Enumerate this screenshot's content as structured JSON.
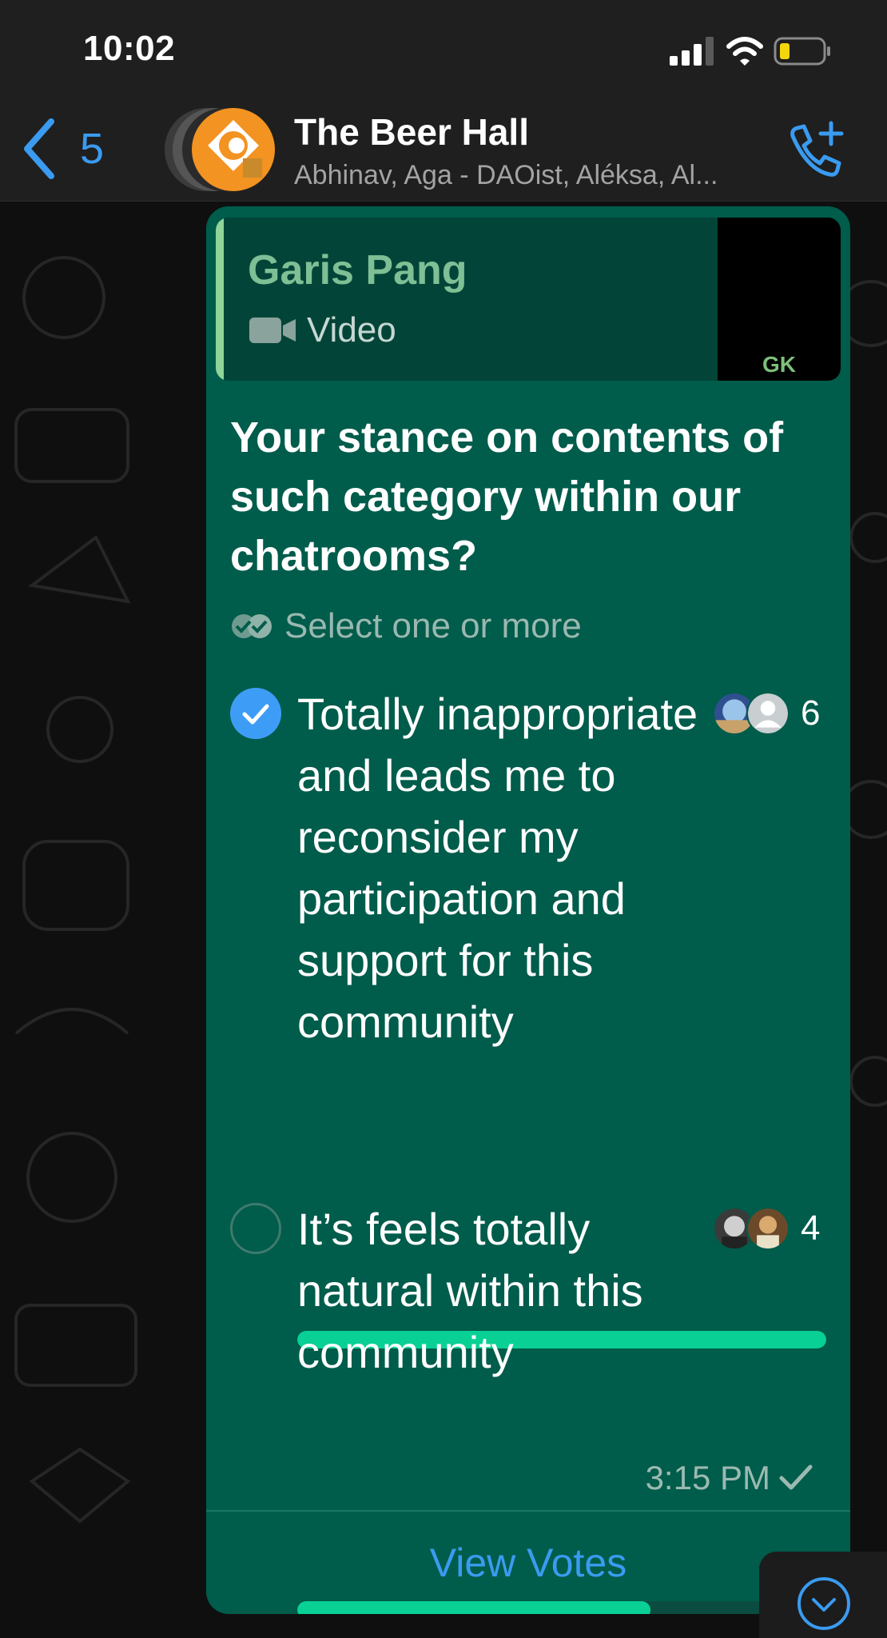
{
  "status": {
    "time": "10:02"
  },
  "header": {
    "back_count": "5",
    "title": "The Beer Hall",
    "subtitle": "Abhinav, Aga - DAOist, Aléksa, Al..."
  },
  "message": {
    "quote": {
      "author": "Garis Pang",
      "type": "Video",
      "thumb_logo": "GK"
    },
    "poll": {
      "question": "Your stance on contents of such category within our chatrooms?",
      "hint": "Select one or more",
      "options": [
        {
          "text": "Totally inappropriate and leads me to reconsider my participation and support for this community",
          "votes": "6",
          "checked": true,
          "fraction": 1.0
        },
        {
          "text": "It’s feels totally natural within this community",
          "votes": "4",
          "checked": false,
          "fraction": 0.667
        }
      ]
    },
    "time": "3:15 PM",
    "view_votes": "View Votes"
  },
  "icons": {
    "back": "chevron-left-icon",
    "call": "add-call-icon",
    "scroll": "chevron-down-circle-icon"
  },
  "colors": {
    "accent": "#3a9bf0",
    "bubble": "#005c4b",
    "bar_fill": "#09d094",
    "quote_author": "#7fbf95"
  }
}
